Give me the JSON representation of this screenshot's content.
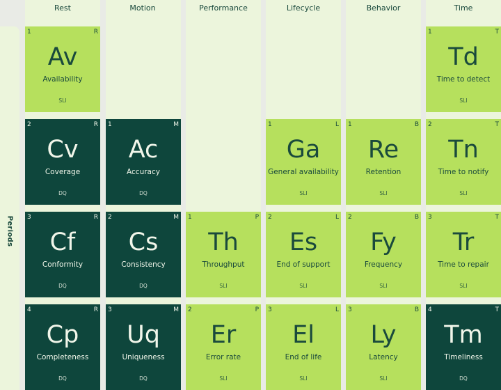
{
  "periods_label": "Periods",
  "colors": {
    "light_tile": "#b6e05d",
    "dark_tile": "#0e463c",
    "column_bg": "#ecf5dc",
    "page_bg": "#e9ebe6"
  },
  "groups": [
    "Rest",
    "Motion",
    "Performance",
    "Lifecycle",
    "Behavior",
    "Time"
  ],
  "tiles": [
    {
      "col": 0,
      "row": 0,
      "num": "1",
      "cat": "R",
      "sym": "Av",
      "name": "Availability",
      "tag": "SLI",
      "style": "light"
    },
    {
      "col": 5,
      "row": 0,
      "num": "1",
      "cat": "T",
      "sym": "Td",
      "name": "Time to detect",
      "tag": "SLI",
      "style": "light"
    },
    {
      "col": 0,
      "row": 1,
      "num": "2",
      "cat": "R",
      "sym": "Cv",
      "name": "Coverage",
      "tag": "DQ",
      "style": "dark"
    },
    {
      "col": 1,
      "row": 1,
      "num": "1",
      "cat": "M",
      "sym": "Ac",
      "name": "Accuracy",
      "tag": "DQ",
      "style": "dark"
    },
    {
      "col": 3,
      "row": 1,
      "num": "1",
      "cat": "L",
      "sym": "Ga",
      "name": "General availability",
      "tag": "SLI",
      "style": "light"
    },
    {
      "col": 4,
      "row": 1,
      "num": "1",
      "cat": "B",
      "sym": "Re",
      "name": "Retention",
      "tag": "SLI",
      "style": "light"
    },
    {
      "col": 5,
      "row": 1,
      "num": "2",
      "cat": "T",
      "sym": "Tn",
      "name": "Time to notify",
      "tag": "SLI",
      "style": "light"
    },
    {
      "col": 0,
      "row": 2,
      "num": "3",
      "cat": "R",
      "sym": "Cf",
      "name": "Conformity",
      "tag": "DQ",
      "style": "dark"
    },
    {
      "col": 1,
      "row": 2,
      "num": "2",
      "cat": "M",
      "sym": "Cs",
      "name": "Consistency",
      "tag": "DQ",
      "style": "dark"
    },
    {
      "col": 2,
      "row": 2,
      "num": "1",
      "cat": "P",
      "sym": "Th",
      "name": "Throughput",
      "tag": "SLI",
      "style": "light"
    },
    {
      "col": 3,
      "row": 2,
      "num": "2",
      "cat": "L",
      "sym": "Es",
      "name": "End of support",
      "tag": "SLI",
      "style": "light"
    },
    {
      "col": 4,
      "row": 2,
      "num": "2",
      "cat": "B",
      "sym": "Fy",
      "name": "Frequency",
      "tag": "SLI",
      "style": "light"
    },
    {
      "col": 5,
      "row": 2,
      "num": "3",
      "cat": "T",
      "sym": "Tr",
      "name": "Time to repair",
      "tag": "SLI",
      "style": "light"
    },
    {
      "col": 0,
      "row": 3,
      "num": "4",
      "cat": "R",
      "sym": "Cp",
      "name": "Completeness",
      "tag": "DQ",
      "style": "dark"
    },
    {
      "col": 1,
      "row": 3,
      "num": "3",
      "cat": "M",
      "sym": "Uq",
      "name": "Uniqueness",
      "tag": "DQ",
      "style": "dark"
    },
    {
      "col": 2,
      "row": 3,
      "num": "2",
      "cat": "P",
      "sym": "Er",
      "name": "Error rate",
      "tag": "SLI",
      "style": "light"
    },
    {
      "col": 3,
      "row": 3,
      "num": "3",
      "cat": "L",
      "sym": "El",
      "name": "End of life",
      "tag": "SLI",
      "style": "light"
    },
    {
      "col": 4,
      "row": 3,
      "num": "3",
      "cat": "B",
      "sym": "Ly",
      "name": "Latency",
      "tag": "SLI",
      "style": "light"
    },
    {
      "col": 5,
      "row": 3,
      "num": "4",
      "cat": "T",
      "sym": "Tm",
      "name": "Timeliness",
      "tag": "DQ",
      "style": "dark"
    }
  ]
}
